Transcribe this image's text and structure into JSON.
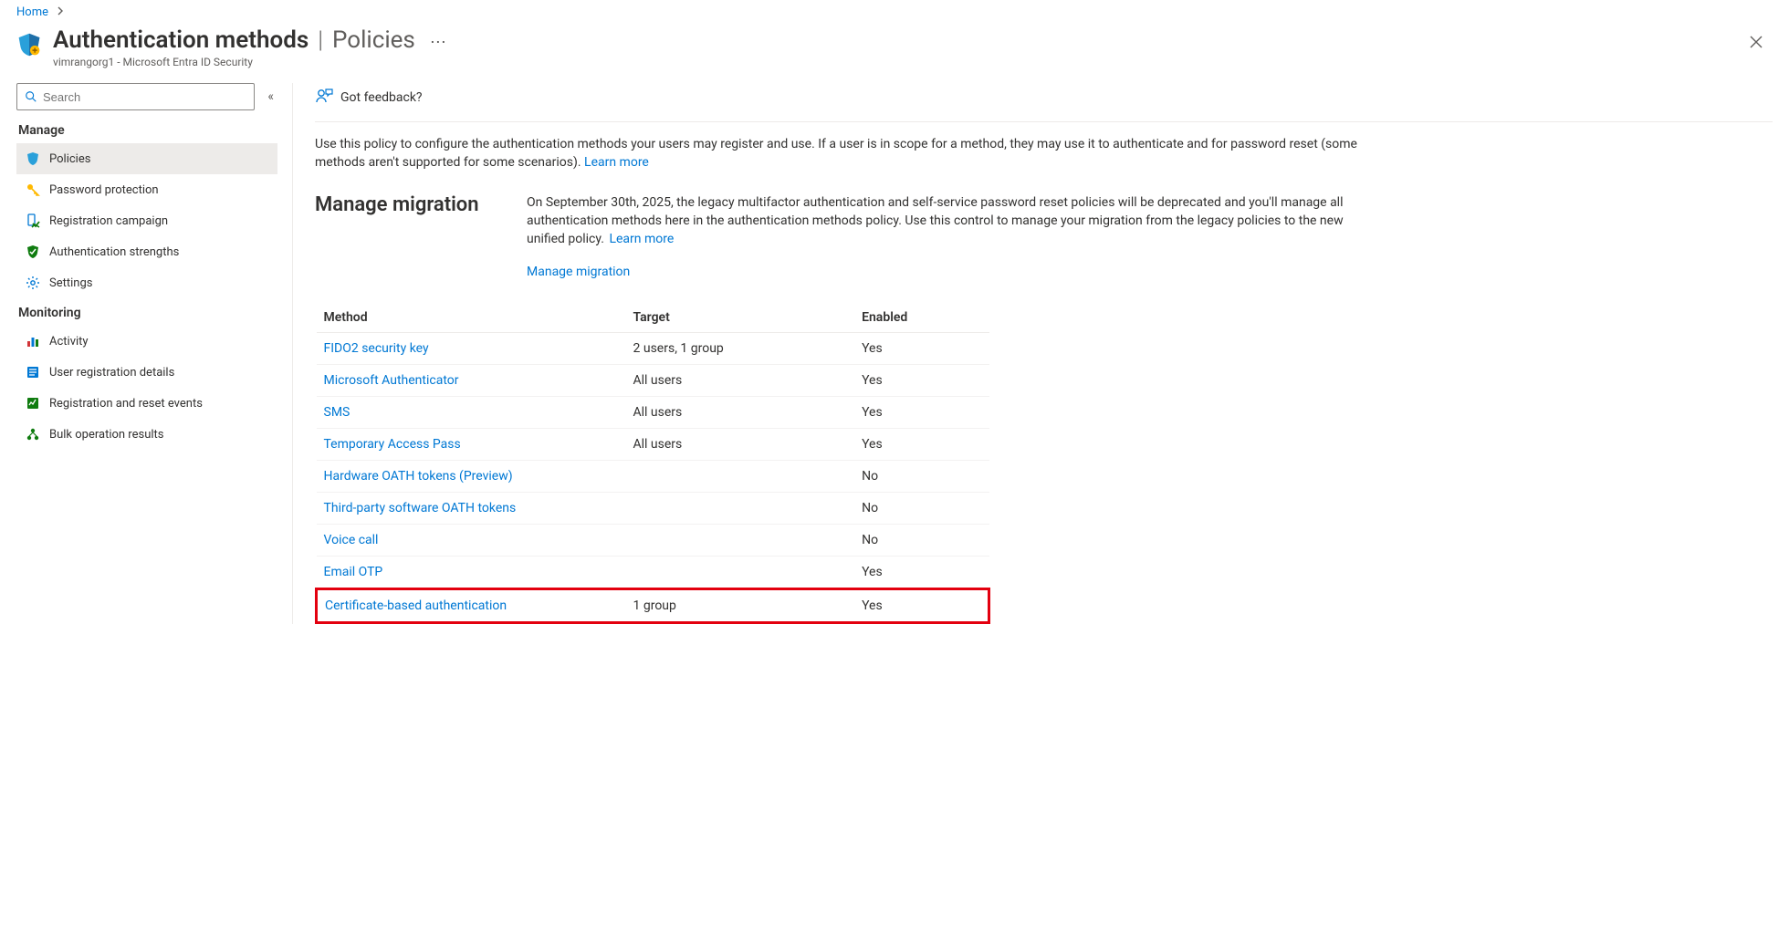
{
  "breadcrumb": {
    "home": "Home"
  },
  "header": {
    "title": "Authentication methods",
    "section": "Policies",
    "subtitle": "vimrangorg1 - Microsoft Entra ID Security"
  },
  "sidebar": {
    "search_placeholder": "Search",
    "sections": {
      "manage": {
        "title": "Manage",
        "items": [
          {
            "label": "Policies"
          },
          {
            "label": "Password protection"
          },
          {
            "label": "Registration campaign"
          },
          {
            "label": "Authentication strengths"
          },
          {
            "label": "Settings"
          }
        ]
      },
      "monitoring": {
        "title": "Monitoring",
        "items": [
          {
            "label": "Activity"
          },
          {
            "label": "User registration details"
          },
          {
            "label": "Registration and reset events"
          },
          {
            "label": "Bulk operation results"
          }
        ]
      }
    }
  },
  "feedback": {
    "label": "Got feedback?"
  },
  "intro": {
    "text": "Use this policy to configure the authentication methods your users may register and use. If a user is in scope for a method, they may use it to authenticate and for password reset (some methods aren't supported for some scenarios). ",
    "learn_more": "Learn more"
  },
  "migration": {
    "title": "Manage migration",
    "text": "On September 30th, 2025, the legacy multifactor authentication and self-service password reset policies will be deprecated and you'll manage all authentication methods here in the authentication methods policy. Use this control to manage your migration from the legacy policies to the new unified policy. ",
    "learn_more": "Learn more",
    "link": "Manage migration"
  },
  "table": {
    "headers": {
      "method": "Method",
      "target": "Target",
      "enabled": "Enabled"
    },
    "rows": [
      {
        "method": "FIDO2 security key",
        "target": "2 users, 1 group",
        "enabled": "Yes"
      },
      {
        "method": "Microsoft Authenticator",
        "target": "All users",
        "enabled": "Yes"
      },
      {
        "method": "SMS",
        "target": "All users",
        "enabled": "Yes"
      },
      {
        "method": "Temporary Access Pass",
        "target": "All users",
        "enabled": "Yes"
      },
      {
        "method": "Hardware OATH tokens (Preview)",
        "target": "",
        "enabled": "No"
      },
      {
        "method": "Third-party software OATH tokens",
        "target": "",
        "enabled": "No"
      },
      {
        "method": "Voice call",
        "target": "",
        "enabled": "No"
      },
      {
        "method": "Email OTP",
        "target": "",
        "enabled": "Yes"
      },
      {
        "method": "Certificate-based authentication",
        "target": "1 group",
        "enabled": "Yes"
      }
    ]
  }
}
